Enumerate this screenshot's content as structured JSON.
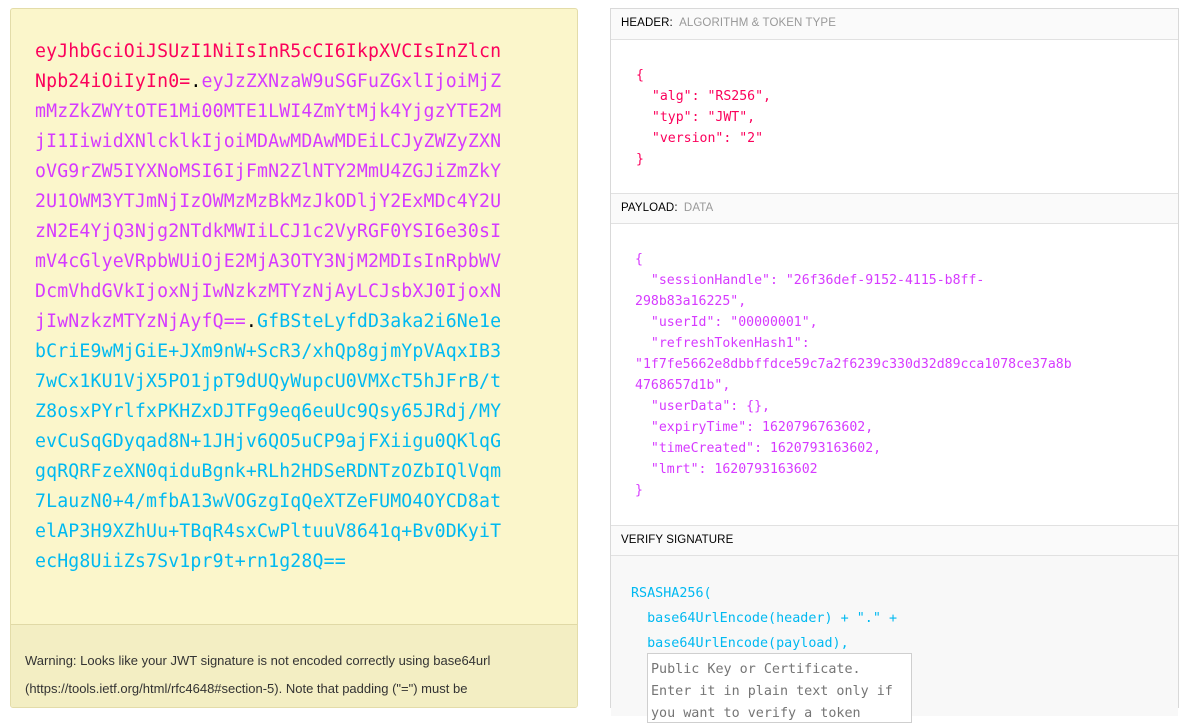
{
  "encoded": {
    "header": "eyJhbGciOiJSUzI1NiIsInR5cCI6IkpXVCIsInZlcnNpb24iOiIyIn0=",
    "payload": "eyJzZXNzaW9uSGFuZGxlIjoiMjZmMzZkZWYtOTE1Mi00MTE1LWI4ZmYtMjk4YjgzYTE2MjI1IiwidXNlcklkIjoiMDAwMDAwMDEiLCJyZWZyZXNoVG9rZW5IYXNoMSI6IjFmN2ZlNTY2MmU4ZGJiZmZkY2U1OWM3YTJmNjIzOWMzMzBkMzJkODljY2ExMDc4Y2UzN2E4YjQ3Njg2NTdkMWIiLCJ1c2VyRGF0YSI6e30sImV4cGlyeVRpbWUiOjE2MjA3OTY3NjM2MDIsInRpbWVDcmVhdGVkIjoxNjIwNzkzMTYzNjAyLCJsbXJ0IjoxNjIwNzkzMTYzNjAyfQ==",
    "signature": "GfBSteLyfdD3aka2i6Ne1ebCriE9wMjGiE+JXm9nW+ScR3/xhQp8gjmYpVAqxIB37wCx1KU1VjX5PO1jpT9dUQyWupcU0VMXcT5hJFrB/tZ8osxPYrlfxPKHZxDJTFg9eq6euUc9Qsy65JRdj/MYevCuSqGDyqad8N+1JHjv6QO5uCP9ajFXiigu0QKlqGgqRQRFzeXN0qiduBgnk+RLh2HDSeRDNTzOZbIQlVqm7LauzN0+4/mfbA13wVOGzgIqQeXTZeFUMO4OYCD8atelAP3H9XZhUu+TBqR4sxCwPltuuV8641q+Bv0DKyiTecHg8UiiZs7Sv1pr9t+rn1g28Q==",
    "dot": "."
  },
  "warning": {
    "label": "Warning:",
    "text": " Looks like your JWT signature is not encoded correctly using base64url (https://tools.ietf.org/html/rfc4648#section-5). Note that padding (\"=\") must be"
  },
  "sections": {
    "header": {
      "title": "HEADER:",
      "subtitle": "ALGORITHM & TOKEN TYPE"
    },
    "payload": {
      "title": "PAYLOAD:",
      "subtitle": "DATA"
    },
    "verify": {
      "title": "VERIFY SIGNATURE",
      "subtitle": ""
    }
  },
  "header_json": "{\n  \"alg\": \"RS256\",\n  \"typ\": \"JWT\",\n  \"version\": \"2\"\n}",
  "payload_json": "{\n  \"sessionHandle\": \"26f36def-9152-4115-b8ff-\n298b83a16225\",\n  \"userId\": \"00000001\",\n  \"refreshTokenHash1\":\n\"1f7fe5662e8dbbffdce59c7a2f6239c330d32d89cca1078ce37a8b\n4768657d1b\",\n  \"userData\": {},\n  \"expiryTime\": 1620796763602,\n  \"timeCreated\": 1620793163602,\n  \"lmrt\": 1620793163602\n}",
  "verify_code": "RSASHA256(\n  base64UrlEncode(header) + \".\" +\n  base64UrlEncode(payload),",
  "public_key_placeholder": "Public Key or Certificate. Enter it in plain text only if you want to verify a token",
  "colors": {
    "header": "#fb015b",
    "payload": "#d63aff",
    "signature": "#00b9f1"
  }
}
